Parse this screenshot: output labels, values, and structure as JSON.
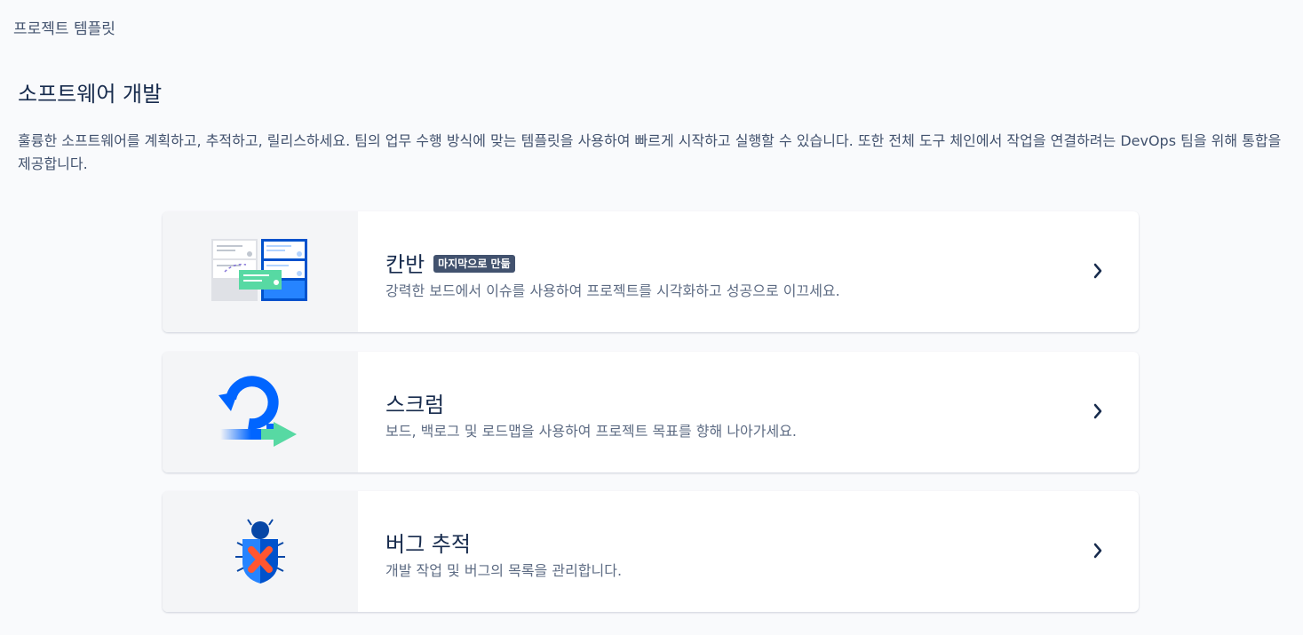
{
  "breadcrumb": "프로젝트 템플릿",
  "section": {
    "title": "소프트웨어 개발",
    "description": "훌륭한 소프트웨어를 계획하고, 추적하고, 릴리스하세요. 팀의 업무 수행 방식에 맞는 템플릿을 사용하여 빠르게 시작하고 실행할 수 있습니다. 또한 전체 도구 체인에서 작업을 연결하려는 DevOps 팀을 위해 통합을 제공합니다."
  },
  "templates": [
    {
      "title": "칸반",
      "badge": "마지막으로 만듦",
      "description": "강력한 보드에서 이슈를 사용하여 프로젝트를 시각화하고 성공으로 이끄세요.",
      "icon": "kanban-board-icon"
    },
    {
      "title": "스크럼",
      "description": "보드, 백로그 및 로드맵을 사용하여 프로젝트 목표를 향해 나아가세요.",
      "icon": "scrum-cycle-icon"
    },
    {
      "title": "버그 추적",
      "description": "개발 작업 및 버그의 목록을 관리합니다.",
      "icon": "bug-shield-icon"
    }
  ],
  "colors": {
    "primary_blue": "#0065ff",
    "green": "#57d9a3",
    "red": "#ff5630",
    "badge_bg": "#42526e"
  }
}
